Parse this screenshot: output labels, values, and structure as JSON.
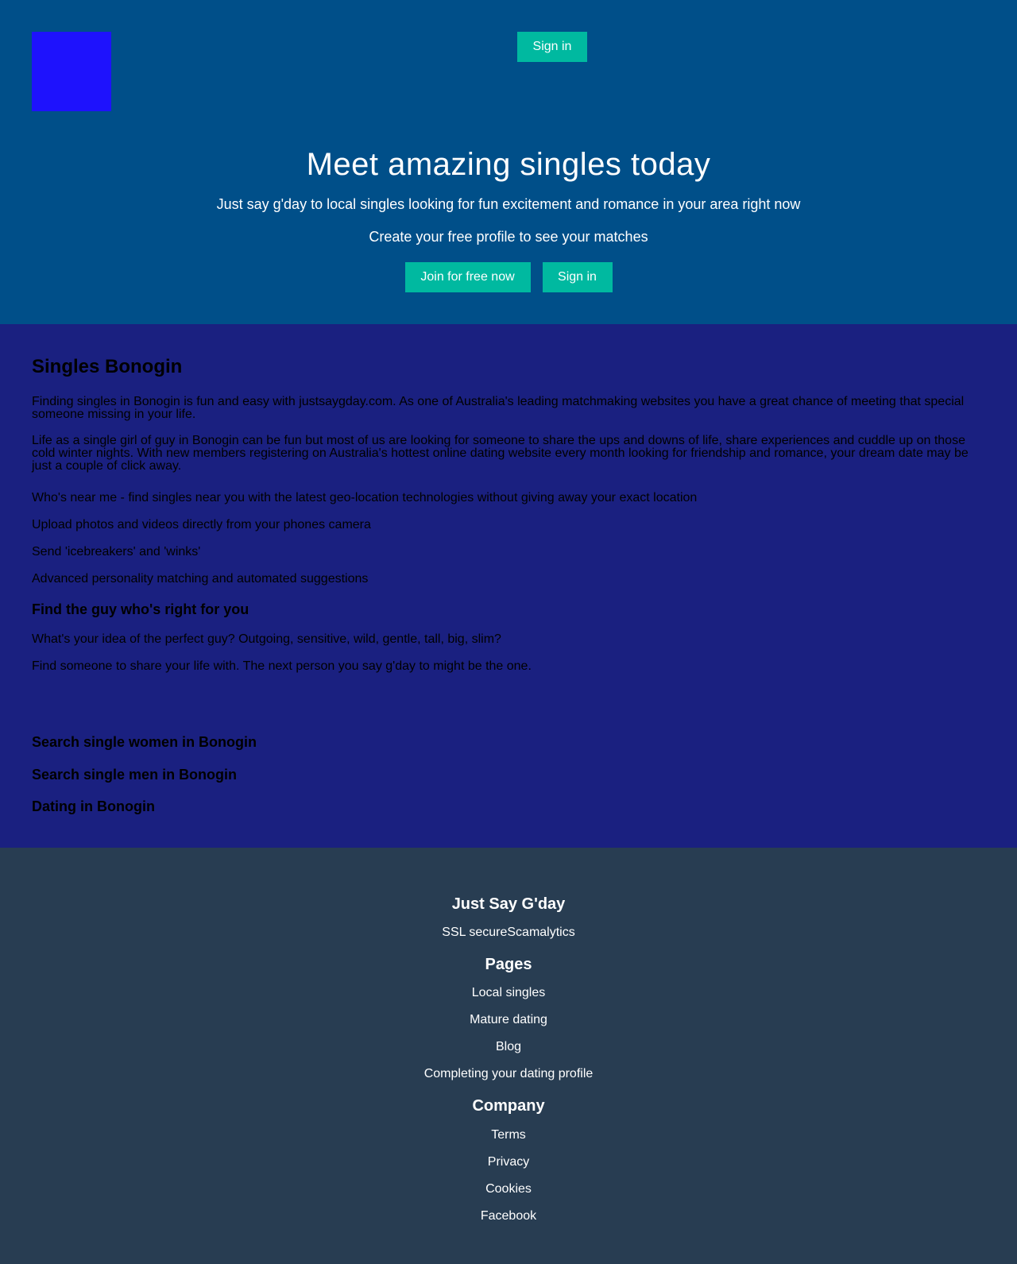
{
  "header": {
    "logo_color": "#1e12fd",
    "sign_in_label": "Sign in"
  },
  "hero": {
    "title": "Meet amazing singles today",
    "subtitle": "Just say g'day to local singles looking for fun excitement and romance in your area right now",
    "cta_text": "Create your free profile to see your matches",
    "join_label": "Join for free now",
    "sign_in_label": "Sign in"
  },
  "main": {
    "heading": "Singles Bonogin",
    "paragraphs": [
      "Finding singles in Bonogin is fun and easy with justsaygday.com. As one of Australia's leading matchmaking websites you have a great chance of meeting that special someone missing in your life.",
      "Life as a single girl of guy in Bonogin can be fun but most of us are looking for someone to share the ups and downs of life, share experiences and cuddle up on those cold winter nights. With new members registering on Australia's hottest online dating website every month looking for friendship and romance, your dream date may be just a couple of click away.",
      "Who's near me - find singles near you with the latest geo-location technologies without giving away your exact location",
      "Upload photos and videos directly from your phones camera",
      "Send 'icebreakers' and 'winks'",
      "Advanced personality matching and automated suggestions"
    ],
    "subheading": "Find the guy who's right for you",
    "sub_paragraphs": [
      "What's your idea of the perfect guy? Outgoing, sensitive, wild, gentle, tall, big, slim?",
      "Find someone to share your life with. The next person you say g'day to might be the one."
    ],
    "search_links": [
      "Search single women in Bonogin",
      "Search single men in Bonogin",
      "Dating in Bonogin"
    ]
  },
  "footer": {
    "brand": "Just Say G'day",
    "badges": "SSL secureScamalytics",
    "pages_heading": "Pages",
    "pages": [
      "Local singles",
      "Mature dating",
      "Blog",
      "Completing your dating profile"
    ],
    "company_heading": "Company",
    "company": [
      "Terms",
      "Privacy",
      "Cookies",
      "Facebook"
    ]
  },
  "colors": {
    "hero_bg": "#004f89",
    "content_bg": "#1a2080",
    "footer_bg": "#283d52",
    "button_bg": "#00b9a0"
  }
}
